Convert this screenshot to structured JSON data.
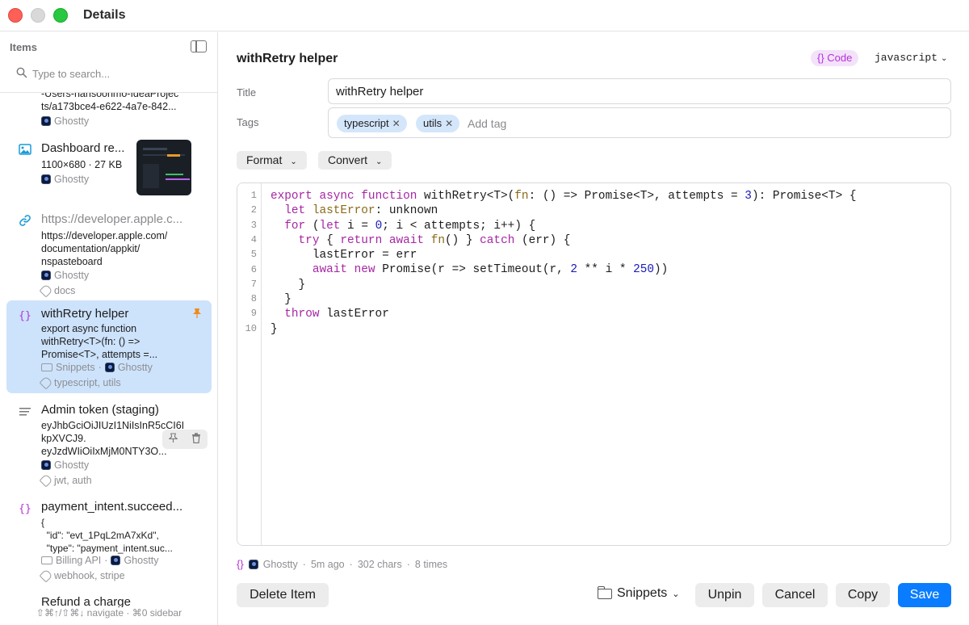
{
  "window": {
    "title": "Details"
  },
  "sidebar": {
    "header": "Items",
    "search_placeholder": "Type to search...",
    "footer": "⇧⌘↑/⇧⌘↓ navigate · ⌘0 sidebar",
    "items": [
      {
        "type": "file",
        "body": "-Users-hansoonmo-IdeaProjec\nts/a173bce4-e622-4a7e-842...",
        "app": "Ghostty"
      },
      {
        "type": "image",
        "title": "Dashboard re...",
        "body": "1100×680 · 27 KB",
        "app": "Ghostty"
      },
      {
        "type": "link",
        "title": "https://developer.apple.c...",
        "body": "https://developer.apple.com/\ndocumentation/appkit/\nnspasteboard",
        "app": "Ghostty",
        "tags": "docs"
      },
      {
        "type": "code",
        "title": "withRetry helper",
        "body": "export async function\nwithRetry<T>(fn: () =>\nPromise<T>, attempts =...",
        "folder": "Snippets",
        "app": "Ghostty",
        "tags": "typescript, utils",
        "pinned": true
      },
      {
        "type": "text",
        "title": "Admin token (staging)",
        "body": "eyJhbGciOiJIUzI1NiIsInR5cCI6I\nkpXVCJ9.\neyJzdWIiOiIxMjM0NTY3O...",
        "app": "Ghostty",
        "tags": "jwt, auth"
      },
      {
        "type": "code",
        "title": "payment_intent.succeed...",
        "body": "{\n  \"id\": \"evt_1PqL2mA7xKd\",\n  \"type\": \"payment_intent.suc...",
        "folder": "Billing API",
        "app": "Ghostty",
        "tags": "webhook, stripe"
      },
      {
        "type": "text",
        "title": "Refund a charge"
      }
    ]
  },
  "detail": {
    "title": "withRetry helper",
    "kind_badge": "{} Code",
    "language": "javascript",
    "title_label": "Title",
    "title_value": "withRetry helper",
    "tags_label": "Tags",
    "tags": [
      "typescript",
      "utils"
    ],
    "add_tag_placeholder": "Add tag",
    "format_label": "Format",
    "convert_label": "Convert",
    "code_lines": [
      "export async function withRetry<T>(fn: () => Promise<T>, attempts = 3): Promise<T> {",
      "  let lastError: unknown",
      "  for (let i = 0; i < attempts; i++) {",
      "    try { return await fn() } catch (err) {",
      "      lastError = err",
      "      await new Promise(r => setTimeout(r, 2 ** i * 250))",
      "    }",
      "  }",
      "  throw lastError",
      "}"
    ],
    "line_numbers": [
      "1",
      "2",
      "3",
      "4",
      "5",
      "6",
      "7",
      "8",
      "9",
      "10"
    ],
    "status": {
      "icon": "{}",
      "app": "Ghostty",
      "time": "5m ago",
      "chars": "302 chars",
      "times": "8 times"
    },
    "buttons": {
      "delete": "Delete Item",
      "folder": "Snippets",
      "unpin": "Unpin",
      "cancel": "Cancel",
      "copy": "Copy",
      "save": "Save"
    }
  },
  "colors": {
    "accent": "#0a7cff",
    "code_badge": "#b333d9",
    "pin": "#f08a1b",
    "selection": "#cde3fb"
  },
  "icons": [
    "search-icon",
    "sidebar-toggle-icon",
    "image-icon",
    "link-icon",
    "code-icon",
    "text-icon",
    "pin-icon",
    "trash-icon",
    "folder-icon",
    "tag-icon",
    "chevron-down-icon"
  ]
}
